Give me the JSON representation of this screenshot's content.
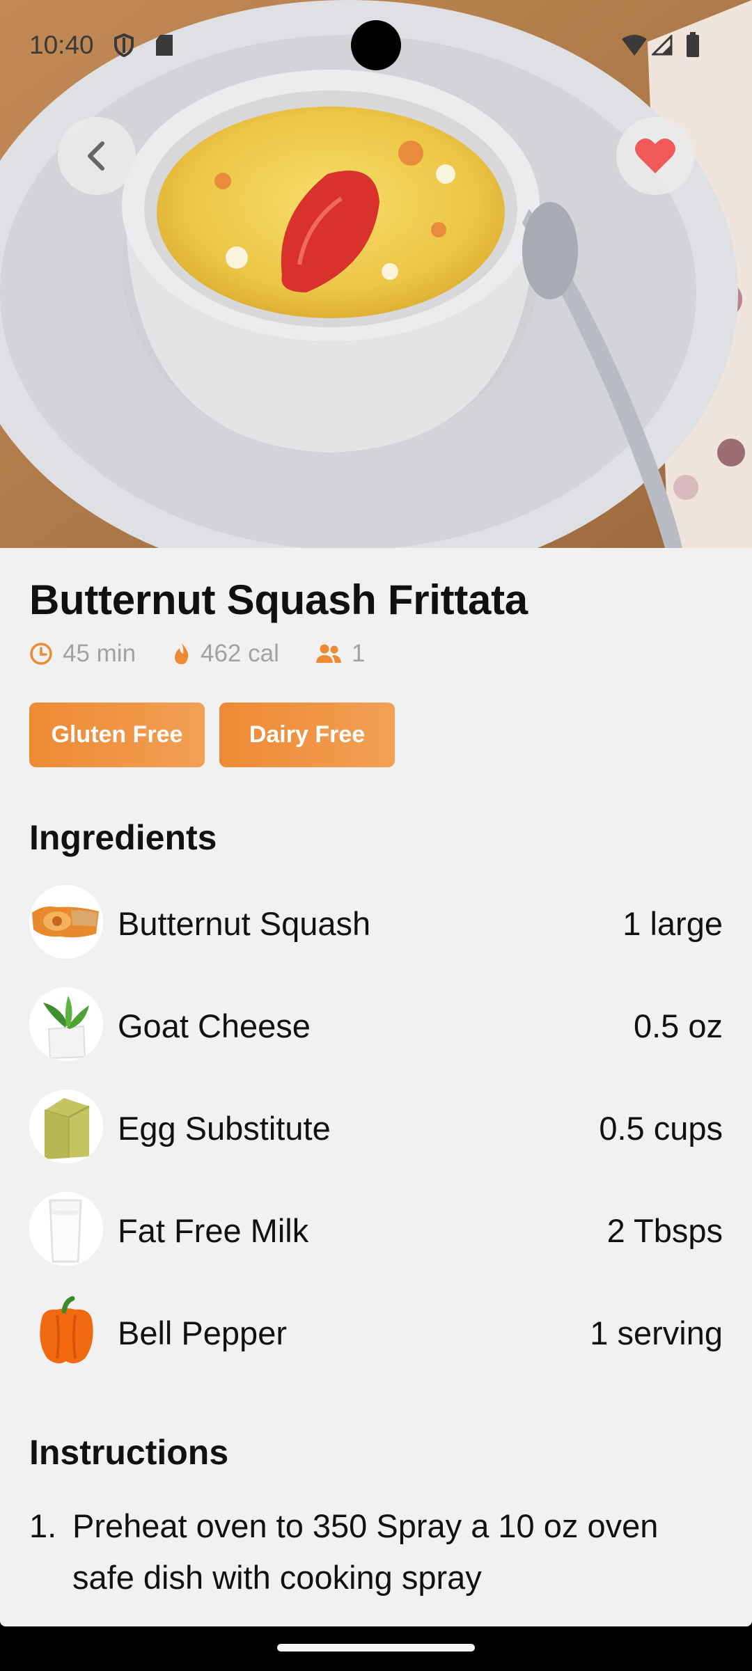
{
  "status_bar": {
    "time": "10:40"
  },
  "recipe": {
    "title": "Butternut Squash Frittata",
    "meta": {
      "time": "45 min",
      "calories": "462 cal",
      "servings": "1"
    },
    "tags": [
      "Gluten Free",
      "Dairy Free"
    ]
  },
  "sections": {
    "ingredients": "Ingredients",
    "instructions": "Instructions"
  },
  "ingredients": [
    {
      "name": "Butternut Squash",
      "amount": "1 large",
      "icon": "butternut-squash"
    },
    {
      "name": "Goat Cheese",
      "amount": "0.5 oz",
      "icon": "goat-cheese"
    },
    {
      "name": "Egg Substitute",
      "amount": "0.5 cups",
      "icon": "egg-substitute-carton"
    },
    {
      "name": "Fat Free Milk",
      "amount": "2 Tbsps",
      "icon": "milk-glass"
    },
    {
      "name": "Bell Pepper",
      "amount": "1 serving",
      "icon": "bell-pepper"
    }
  ],
  "instructions": [
    {
      "number": "1.",
      "text": "Preheat oven to 350 Spray a 10 oz oven safe dish with cooking spray"
    }
  ],
  "colors": {
    "accent": "#ED8A34",
    "favorite": "#F05A5A",
    "background": "#F1F1F1"
  }
}
